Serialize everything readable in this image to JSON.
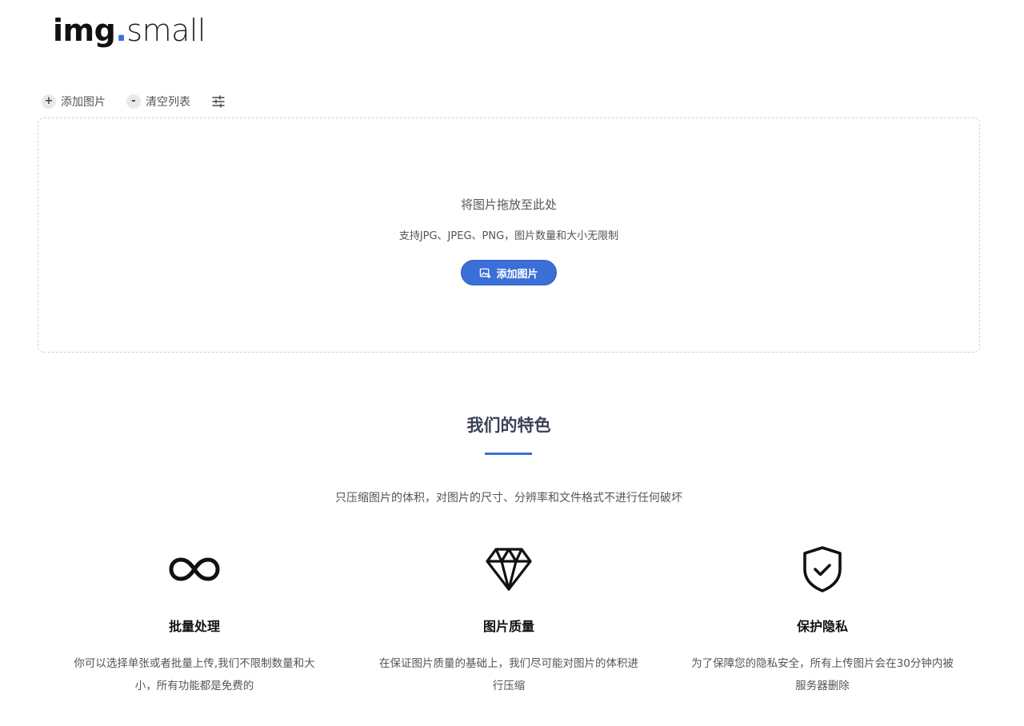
{
  "logo": {
    "part1": "img",
    "dot": ".",
    "part2": "small"
  },
  "toolbar": {
    "add_label": "添加图片",
    "add_symbol": "+",
    "clear_label": "清空列表",
    "clear_symbol": "-"
  },
  "dropzone": {
    "title": "将图片拖放至此处",
    "subtitle": "支持JPG、JPEG、PNG，图片数量和大小无限制",
    "button_label": "添加图片"
  },
  "features_section": {
    "title": "我们的特色",
    "subtitle": "只压缩图片的体积，对图片的尺寸、分辨率和文件格式不进行任何破坏",
    "items": [
      {
        "icon": "infinity-icon",
        "title": "批量处理",
        "desc": "你可以选择单张或者批量上传,我们不限制数量和大小，所有功能都是免费的"
      },
      {
        "icon": "diamond-icon",
        "title": "图片质量",
        "desc": "在保证图片质量的基础上，我们尽可能对图片的体积进行压缩"
      },
      {
        "icon": "shield-check-icon",
        "title": "保护隐私",
        "desc": "为了保障您的隐私安全，所有上传图片会在30分钟内被服务器删除"
      }
    ]
  },
  "colors": {
    "accent": "#3b6fd8",
    "title": "#3a4257",
    "text": "#555555",
    "border": "#cfd3da"
  }
}
